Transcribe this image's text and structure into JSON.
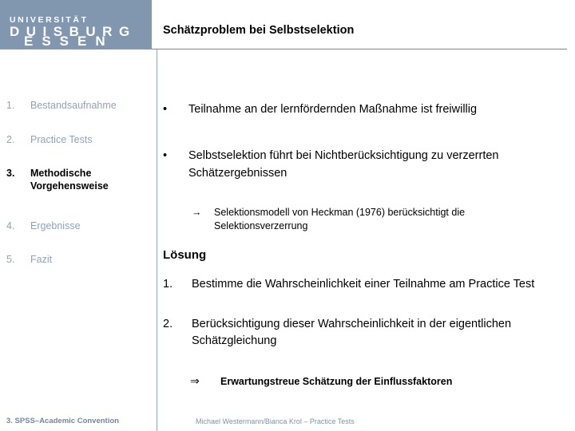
{
  "logo": {
    "line1": "UNIVERSITÄT",
    "line2": "DUISBURG",
    "line3": "ESSEN",
    "bg_color": "#8197b0"
  },
  "header": {
    "title": "Schätzproblem bei Selbstselektion",
    "rule_color": "#6f87a3"
  },
  "sidebar": {
    "inactive_color": "#8fa3b5",
    "active_color": "#000000",
    "items": [
      {
        "number": "1.",
        "label": "Bestandsaufnahme",
        "active": false
      },
      {
        "number": "2.",
        "label": "Practice Tests",
        "active": false
      },
      {
        "number": "3.",
        "label": "Methodische Vorgehensweise",
        "active": true
      },
      {
        "number": "4.",
        "label": "Ergebnisse",
        "active": false
      },
      {
        "number": "5.",
        "label": "Fazit",
        "active": false
      }
    ]
  },
  "main": {
    "bullets": [
      {
        "mark": "•",
        "text": "Teilnahme an der lernfördernden Maßnahme ist freiwillig"
      },
      {
        "mark": "•",
        "text": "Selbstselektion führt bei Nichtberücksichtigung zu verzerrten Schätzergebnissen"
      }
    ],
    "arrow_note": {
      "mark": "→",
      "text": "Selektionsmodell von Heckman (1976) berücksichtigt die Selektionsverzerrung"
    },
    "solution_heading": "Lösung",
    "numbered": [
      {
        "number": "1.",
        "text": "Bestimme die Wahrscheinlichkeit einer Teilnahme am Practice Test"
      },
      {
        "number": "2.",
        "text": "Berücksichtigung dieser Wahrscheinlichkeit in der eigentlichen Schätzgleichung"
      }
    ],
    "conclusion": {
      "mark": "⇒",
      "text": "Erwartungstreue Schätzung der Einflussfaktoren"
    }
  },
  "footer": {
    "left": "3. SPSS–Academic Convention",
    "center": "Michael Westermann/Bianca Krol – Practice Tests",
    "color": "#6f87a3"
  }
}
